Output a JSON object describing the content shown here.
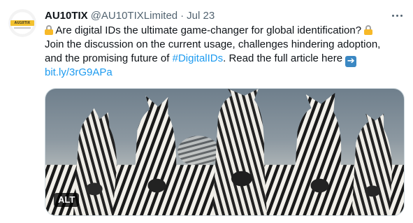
{
  "account": {
    "name": "AU10TIX",
    "handle": "@AU10TIXLimited",
    "separator": "·",
    "date": "Jul 23",
    "avatar_logo_text": "AU10TIX"
  },
  "tweet": {
    "line1": "Are digital IDs the ultimate game-changer for global identification?",
    "line2": "Join the discussion on the current usage, challenges hindering adoption,",
    "line3_before": "and the promising future of ",
    "hashtag": "#DigitalIDs",
    "line3_after": ".  Read the full article here",
    "link": "bit.ly/3rG9APa"
  },
  "media": {
    "alt_badge": "ALT"
  },
  "icons": {
    "more": "more-options-icon",
    "lock": "locked-lock-emoji",
    "arrow": "right-arrow-emoji"
  },
  "colors": {
    "link": "#1d9bf0",
    "text": "#0f1419",
    "muted": "#536471",
    "logo_yellow": "#f2c12e"
  }
}
